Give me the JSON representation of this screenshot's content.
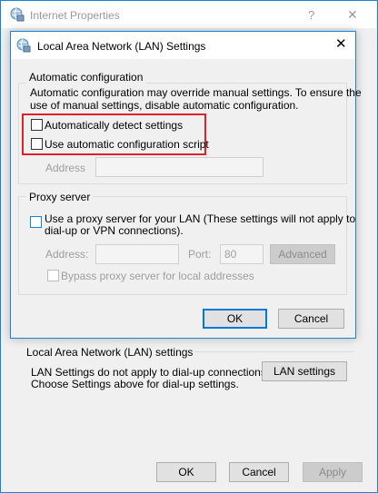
{
  "outer_window": {
    "title": "Internet Properties",
    "help_label": "?",
    "close_label": "✕",
    "lan_section": {
      "legend": "Local Area Network (LAN) settings",
      "info_line1": "LAN Settings do not apply to dial-up connections.",
      "info_line2": "Choose Settings above for dial-up settings.",
      "lan_settings_button": "LAN settings"
    },
    "buttons": {
      "ok": "OK",
      "cancel": "Cancel",
      "apply": "Apply"
    }
  },
  "dialog": {
    "title": "Local Area Network (LAN) Settings",
    "close_label": "✕",
    "automatic_configuration": {
      "legend": "Automatic configuration",
      "description_line1": "Automatic configuration may override manual settings.  To ensure the",
      "description_line2": "use of manual settings, disable automatic configuration.",
      "auto_detect_label": "Automatically detect settings",
      "auto_detect_checked": false,
      "use_script_label": "Use automatic configuration script",
      "use_script_checked": false,
      "address_label": "Address",
      "address_value": ""
    },
    "proxy_server": {
      "legend": "Proxy server",
      "use_proxy_line1": "Use a proxy server for your LAN (These settings will not apply to",
      "use_proxy_line2": "dial-up or VPN connections).",
      "use_proxy_checked": false,
      "address_label": "Address:",
      "address_value": "",
      "port_label": "Port:",
      "port_value": "80",
      "advanced_button": "Advanced",
      "bypass_label": "Bypass proxy server for local addresses",
      "bypass_checked": false
    },
    "buttons": {
      "ok": "OK",
      "cancel": "Cancel"
    }
  },
  "colors": {
    "window_border": "#1883d7",
    "highlight_box": "#e0202a",
    "default_button_border": "#0078d7"
  },
  "icons": {
    "app_icon": "internet-globe-icon"
  }
}
